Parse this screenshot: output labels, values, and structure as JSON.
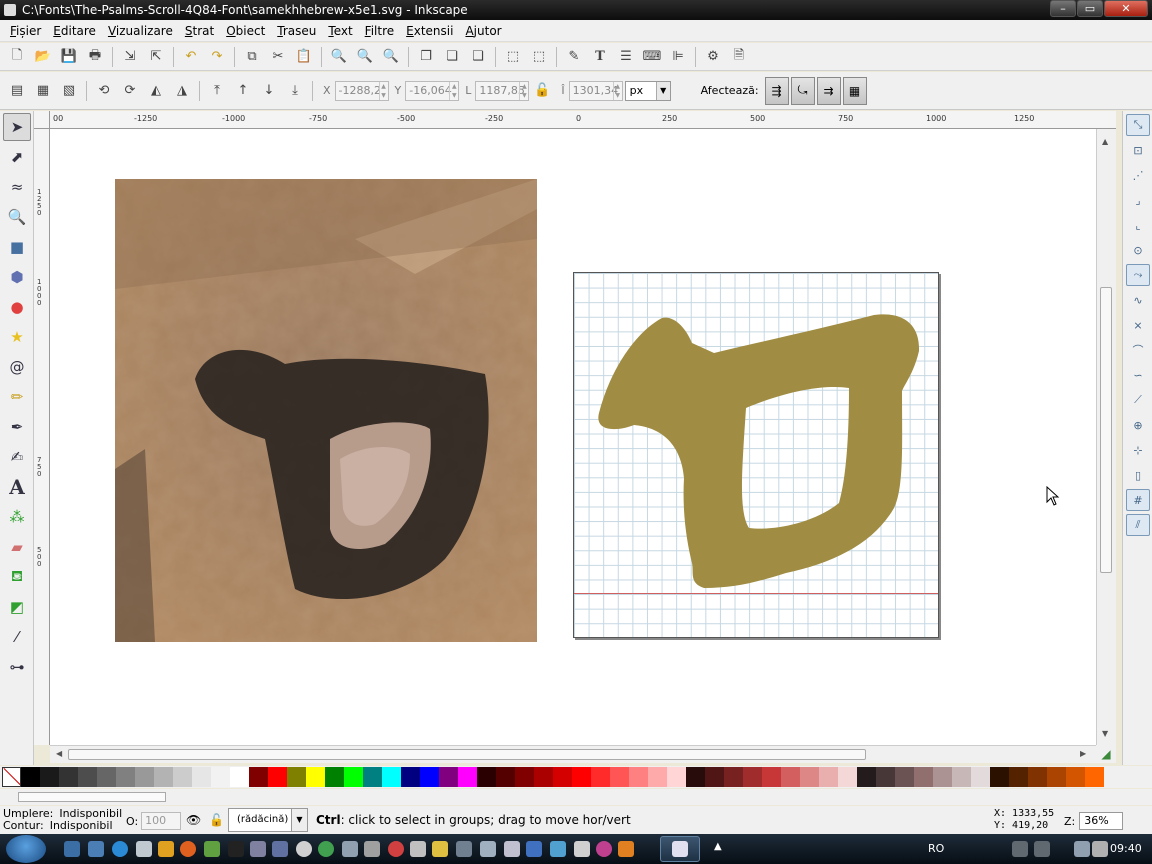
{
  "window": {
    "title": "C:\\Fonts\\The-Psalms-Scroll-4Q84-Font\\samekhhebrew-x5e1.svg - Inkscape",
    "minimize": "–",
    "maximize": "▭",
    "close": "✕"
  },
  "menu": [
    "Fișier",
    "Editare",
    "Vizualizare",
    "Strat",
    "Obiect",
    "Traseu",
    "Text",
    "Filtre",
    "Extensii",
    "Ajutor"
  ],
  "toolbar_icons": [
    "new-document-icon",
    "open-icon",
    "save-icon",
    "print-icon",
    "import-icon",
    "export-icon",
    "undo-icon",
    "redo-icon",
    "copy-icon",
    "cut-icon",
    "paste-icon",
    "zoom-selection-icon",
    "zoom-drawing-icon",
    "zoom-page-icon",
    "duplicate-icon",
    "clone-icon",
    "unlink-clone-icon",
    "group-icon",
    "ungroup-icon",
    "fill-stroke-icon",
    "text-font-icon",
    "layers-icon",
    "xml-editor-icon",
    "align-distribute-icon",
    "preferences-icon",
    "document-properties-icon"
  ],
  "tool_controls": {
    "x_label": "X",
    "x_value": "-1288,2",
    "y_label": "Y",
    "y_value": "-16,064",
    "w_label": "L",
    "w_value": "1187,85",
    "h_label": "Î",
    "h_value": "1301,34",
    "unit": "px",
    "affect_label": "Afectează:"
  },
  "tools": [
    "selector",
    "node",
    "tweak",
    "zoom",
    "rectangle",
    "3d-box",
    "ellipse",
    "star",
    "spiral",
    "pencil",
    "pen",
    "calligraphy",
    "text",
    "spray",
    "eraser",
    "paint-bucket",
    "gradient",
    "dropper",
    "connector"
  ],
  "ruler_h": [
    "00",
    "-1250",
    "-1000",
    "-750",
    "-500",
    "-250",
    "0",
    "250",
    "500",
    "750",
    "1000",
    "1250"
  ],
  "ruler_v": [
    "1250",
    "1000",
    "750",
    "500"
  ],
  "colors": {
    "glyph_fill": "#a08c42",
    "grid_line": "#c5d7e2",
    "baseline": "#d06060"
  },
  "palette": [
    "#000000",
    "#1a1a1a",
    "#333333",
    "#4d4d4d",
    "#666666",
    "#808080",
    "#999999",
    "#b3b3b3",
    "#cccccc",
    "#e6e6e6",
    "#f2f2f2",
    "#ffffff",
    "#800000",
    "#ff0000",
    "#808000",
    "#ffff00",
    "#008000",
    "#00ff00",
    "#008080",
    "#00ffff",
    "#000080",
    "#0000ff",
    "#800080",
    "#ff00ff",
    "#2b0000",
    "#550000",
    "#800000",
    "#aa0000",
    "#d40000",
    "#ff0000",
    "#ff2a2a",
    "#ff5555",
    "#ff8080",
    "#ffaaaa",
    "#ffd5d5",
    "#280b0b",
    "#501616",
    "#782121",
    "#a02c2c",
    "#c83737",
    "#d35f5f",
    "#de8787",
    "#e9afaf",
    "#f4d7d7",
    "#241c1c",
    "#483737",
    "#6c5353",
    "#916f6f",
    "#ac9393",
    "#c8b7b7",
    "#e3dbdb",
    "#2b1100",
    "#552200",
    "#803300",
    "#aa4400",
    "#d45500",
    "#ff6600"
  ],
  "status": {
    "fill_label": "Umplere:",
    "fill_value": "Indisponibil",
    "stroke_label": "Contur:",
    "stroke_value": "Indisponibil",
    "opacity_label": "O:",
    "opacity_value": "100",
    "layer": "(rădăcină)",
    "message_key": "Ctrl",
    "message_text": ": click to select in groups; drag to move hor/vert",
    "cursor_x": "X: 1333,55",
    "cursor_y": "Y:  419,20",
    "zoom_label": "Z:",
    "zoom_value": "36%"
  },
  "taskbar": {
    "language": "RO",
    "time": "09:40"
  }
}
